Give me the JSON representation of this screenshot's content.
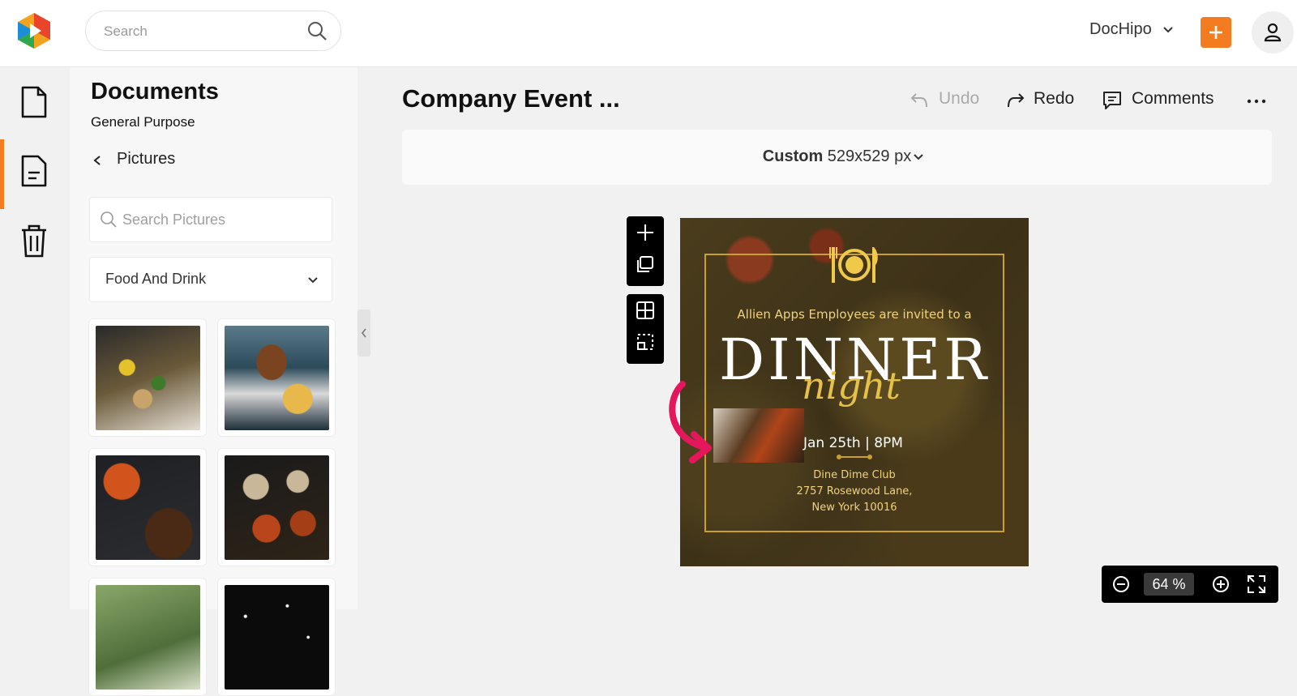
{
  "header": {
    "search_placeholder": "Search",
    "workspace": "DocHipo",
    "add_icon": "plus-icon",
    "accent": "#f47c20"
  },
  "rail": {
    "items": [
      {
        "name": "documents",
        "icon": "file-icon"
      },
      {
        "name": "templates",
        "icon": "document-text-icon",
        "active": true
      },
      {
        "name": "trash",
        "icon": "trash-icon"
      }
    ]
  },
  "panel": {
    "title": "Documents",
    "subtitle": "General Purpose",
    "back_label": "Pictures",
    "search_placeholder": "Search Pictures",
    "category": "Food And Drink",
    "thumbnails": [
      "skewers",
      "burger and fries",
      "coffee beans cup",
      "plated food",
      "green blur",
      "dark sparkle"
    ]
  },
  "editor": {
    "doc_title": "Company Event ...",
    "undo": "Undo",
    "redo": "Redo",
    "comments": "Comments",
    "size_name": "Custom",
    "size_value": "529x529 px",
    "zoom": "64",
    "zoom_unit": "%"
  },
  "design": {
    "invite": "Allien Apps Employees are invited to a",
    "title": "DINNER",
    "subtitle": "night",
    "date": "Jan 25th | 8PM",
    "venue_line1": "Dine Dime Club",
    "venue_line2": "2757 Rosewood Lane,",
    "venue_line3": "New York 10016"
  }
}
